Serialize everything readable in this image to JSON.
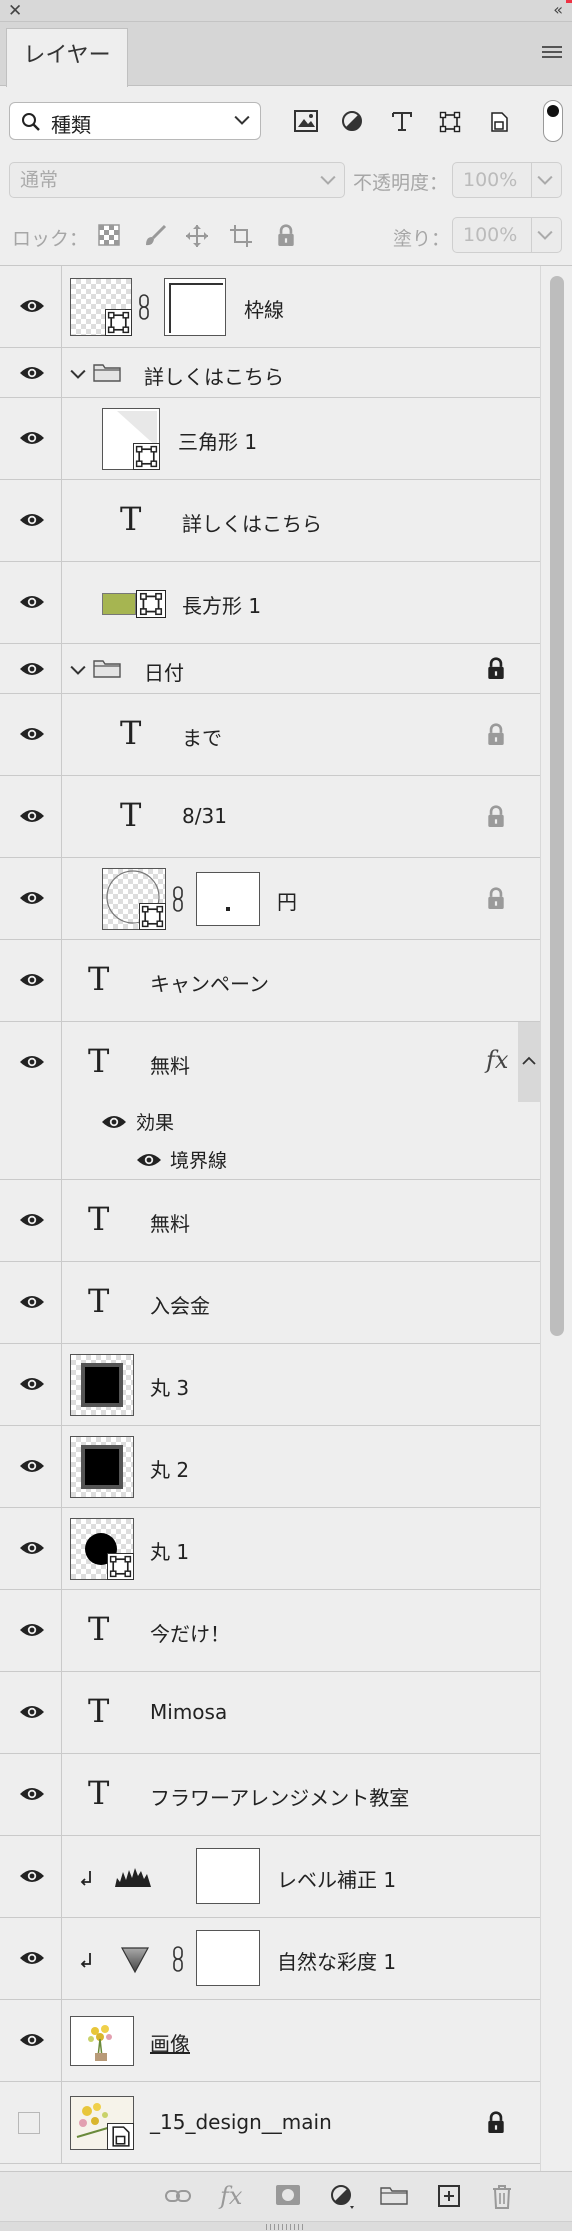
{
  "panel": {
    "tab_label": "レイヤー"
  },
  "filter": {
    "kind_label": "種類"
  },
  "blend": {
    "mode": "通常",
    "opacity_label": "不透明度：",
    "opacity_value": "100%",
    "fill_label": "塗り：",
    "fill_value": "100%"
  },
  "lock": {
    "label": "ロック："
  },
  "layers": [
    {
      "name": "枠線"
    },
    {
      "name": "詳しくはこちら"
    },
    {
      "name": "三角形 1"
    },
    {
      "name": "詳しくはこちら"
    },
    {
      "name": "長方形 1"
    },
    {
      "name": "日付"
    },
    {
      "name": "まで"
    },
    {
      "name": "8/31"
    },
    {
      "name": "円"
    },
    {
      "name": "キャンペーン"
    },
    {
      "name": "無料",
      "effects_label": "効果",
      "effect_item": "境界線",
      "fx_label": "fx"
    },
    {
      "name": "無料"
    },
    {
      "name": "入会金"
    },
    {
      "name": "丸 3"
    },
    {
      "name": "丸 2"
    },
    {
      "name": "丸 1"
    },
    {
      "name": "今だけ！"
    },
    {
      "name": "Mimosa"
    },
    {
      "name": "フラワーアレンジメント教室"
    },
    {
      "name": "レベル補正 1"
    },
    {
      "name": "自然な彩度 1"
    },
    {
      "name": "画像"
    },
    {
      "name": "_15_design__main"
    }
  ],
  "icons": {
    "visibility": "eye-icon",
    "lock": "lock-icon",
    "folder": "folder-icon",
    "text": "type-layer-icon",
    "link": "chain-link-icon",
    "clip": "clipping-arrow-icon"
  },
  "colors": {
    "panel_bg": "#eeeeee",
    "rect_fill": "#a6b551",
    "divider": "#cacaca"
  }
}
